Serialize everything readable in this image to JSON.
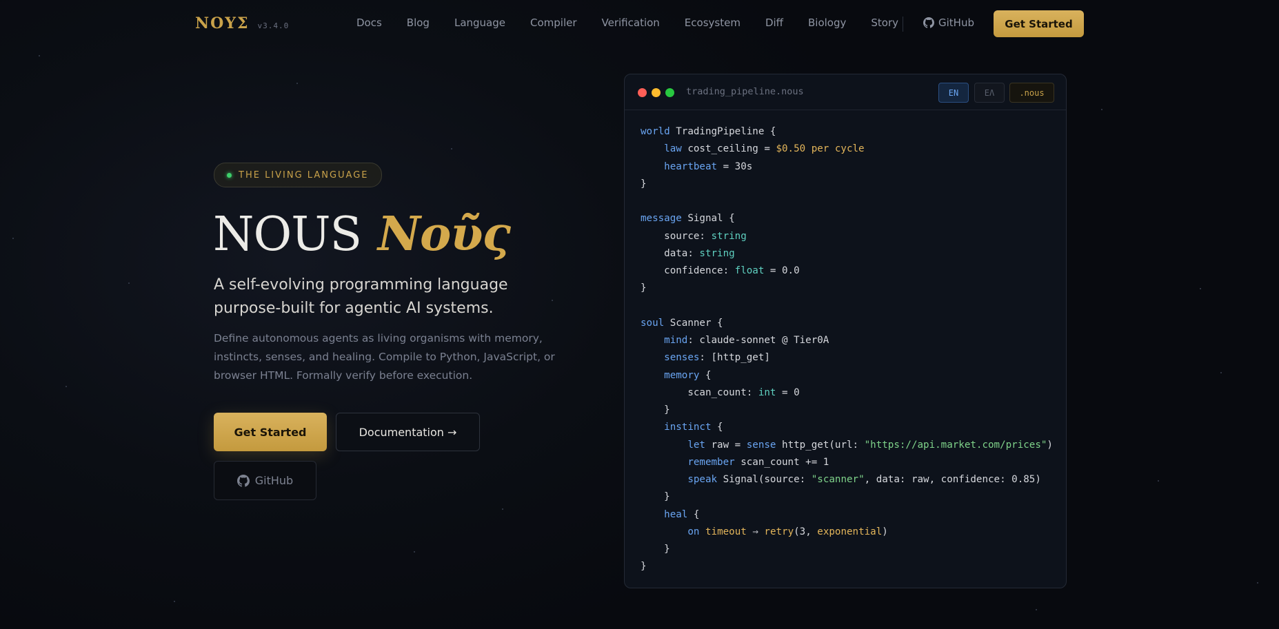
{
  "nav": {
    "logo": "ΝΟΥΣ",
    "version": "v3.4.0",
    "links": [
      "Docs",
      "Blog",
      "Language",
      "Compiler",
      "Verification",
      "Ecosystem",
      "Diff",
      "Biology",
      "Story"
    ],
    "github": "GitHub",
    "cta": "Get Started"
  },
  "hero": {
    "badge": "THE LIVING LANGUAGE",
    "title_latin": "NOUS",
    "title_greek": "Νοῦς",
    "subtitle": "A self-evolving programming language purpose-built for agentic AI systems.",
    "description": "Define autonomous agents as living organisms with memory, instincts, senses, and healing. Compile to Python, JavaScript, or browser HTML. Formally verify before execution.",
    "primary_button": "Get Started",
    "docs_button": "Documentation →",
    "github_button": "GitHub"
  },
  "editor": {
    "filename": "trading_pipeline.nous",
    "tabs": {
      "en": "EN",
      "el": "ΕΛ",
      "ext": ".nous"
    },
    "window_dot_colors": [
      "#ff5f57",
      "#febc2e",
      "#28c840"
    ],
    "code_lines": [
      [
        {
          "t": "world",
          "c": "kw"
        },
        {
          "t": " TradingPipeline {"
        }
      ],
      [
        {
          "t": "    "
        },
        {
          "t": "law",
          "c": "kw"
        },
        {
          "t": " cost_ceiling = "
        },
        {
          "t": "$0.50 per cycle",
          "c": "nm"
        }
      ],
      [
        {
          "t": "    "
        },
        {
          "t": "heartbeat",
          "c": "kw"
        },
        {
          "t": " = 30s"
        }
      ],
      [
        {
          "t": "}"
        }
      ],
      [
        {
          "t": ""
        }
      ],
      [
        {
          "t": "message",
          "c": "kw"
        },
        {
          "t": " Signal {"
        }
      ],
      [
        {
          "t": "    source: "
        },
        {
          "t": "string",
          "c": "tp"
        }
      ],
      [
        {
          "t": "    data: "
        },
        {
          "t": "string",
          "c": "tp"
        }
      ],
      [
        {
          "t": "    confidence: "
        },
        {
          "t": "float",
          "c": "tp"
        },
        {
          "t": " = 0.0"
        }
      ],
      [
        {
          "t": "}"
        }
      ],
      [
        {
          "t": ""
        }
      ],
      [
        {
          "t": "soul",
          "c": "kw"
        },
        {
          "t": " Scanner {"
        }
      ],
      [
        {
          "t": "    "
        },
        {
          "t": "mind",
          "c": "kw"
        },
        {
          "t": ": claude-sonnet @ Tier0A"
        }
      ],
      [
        {
          "t": "    "
        },
        {
          "t": "senses",
          "c": "kw"
        },
        {
          "t": ": [http_get]"
        }
      ],
      [
        {
          "t": "    "
        },
        {
          "t": "memory",
          "c": "kw"
        },
        {
          "t": " {"
        }
      ],
      [
        {
          "t": "        scan_count: "
        },
        {
          "t": "int",
          "c": "tp"
        },
        {
          "t": " = 0"
        }
      ],
      [
        {
          "t": "    }"
        }
      ],
      [
        {
          "t": "    "
        },
        {
          "t": "instinct",
          "c": "kw"
        },
        {
          "t": " {"
        }
      ],
      [
        {
          "t": "        "
        },
        {
          "t": "let",
          "c": "kw"
        },
        {
          "t": " raw = "
        },
        {
          "t": "sense",
          "c": "kw"
        },
        {
          "t": " http_get(url: "
        },
        {
          "t": "\"https://api.market.com/prices\"",
          "c": "st"
        },
        {
          "t": ")"
        }
      ],
      [
        {
          "t": "        "
        },
        {
          "t": "remember",
          "c": "kw"
        },
        {
          "t": " scan_count += 1"
        }
      ],
      [
        {
          "t": "        "
        },
        {
          "t": "speak",
          "c": "kw"
        },
        {
          "t": " Signal(source: "
        },
        {
          "t": "\"scanner\"",
          "c": "st"
        },
        {
          "t": ", data: raw, confidence: 0.85)"
        }
      ],
      [
        {
          "t": "    }"
        }
      ],
      [
        {
          "t": "    "
        },
        {
          "t": "heal",
          "c": "kw"
        },
        {
          "t": " {"
        }
      ],
      [
        {
          "t": "        "
        },
        {
          "t": "on",
          "c": "kw"
        },
        {
          "t": " "
        },
        {
          "t": "timeout",
          "c": "fn"
        },
        {
          "t": " ⇒ "
        },
        {
          "t": "retry",
          "c": "fn"
        },
        {
          "t": "(3, "
        },
        {
          "t": "exponential",
          "c": "fn"
        },
        {
          "t": ")"
        }
      ],
      [
        {
          "t": "    }"
        }
      ],
      [
        {
          "t": "}"
        }
      ]
    ]
  },
  "colors": {
    "accent_gold": "#c9a24a",
    "badge_dot": "#3ecf6b",
    "keyword_blue": "#6aa5f2"
  }
}
